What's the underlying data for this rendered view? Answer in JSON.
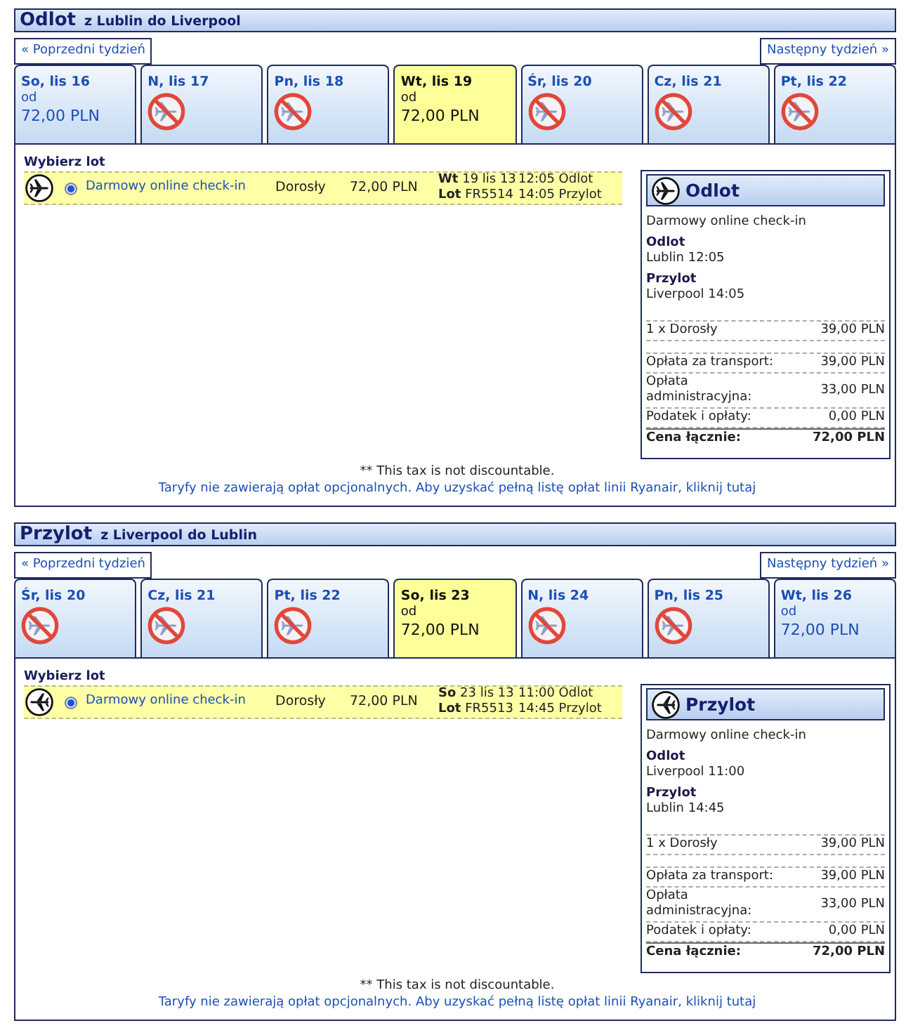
{
  "sections": [
    {
      "kind": "outbound",
      "title": "Odlot",
      "route": "z Lublin do Liverpool",
      "prev_week": "« Poprzedni tydzień",
      "next_week": "Następny tydzień »",
      "days": [
        {
          "label": "So, lis 16",
          "available": true,
          "from": "od",
          "price": "72,00 PLN",
          "selected": false
        },
        {
          "label": "N, lis 17",
          "available": false,
          "selected": false
        },
        {
          "label": "Pn, lis 18",
          "available": false,
          "selected": false
        },
        {
          "label": "Wt, lis 19",
          "available": true,
          "from": "od",
          "price": "72,00 PLN",
          "selected": true
        },
        {
          "label": "Śr, lis 20",
          "available": false,
          "selected": false
        },
        {
          "label": "Cz, lis 21",
          "available": false,
          "selected": false
        },
        {
          "label": "Pt, lis 22",
          "available": false,
          "selected": false
        }
      ],
      "choose_label": "Wybierz lot",
      "flight": {
        "selected": true,
        "fare": "Darmowy online check-in",
        "passenger": "Dorosły",
        "price": "72,00 PLN",
        "date": "**Wt** 19 lis 13",
        "flight_number": "**Lot** FR5514",
        "departure": "12:05 Odlot",
        "arrival": "14:05 Przylot"
      },
      "summary": {
        "title": "Odlot",
        "fare": "Darmowy online check-in",
        "departure_heading": "Odlot",
        "departure": "Lublin 12:05",
        "arrival_heading": "Przylot",
        "arrival": "Liverpool 14:05",
        "passengers": [
          {
            "label": "1 x Dorosły",
            "amount": "39,00 PLN"
          }
        ],
        "fees": [
          {
            "label": "Opłata za transport:",
            "amount": "39,00 PLN"
          },
          {
            "label": "Opłata administracyjna:",
            "amount": "33,00 PLN"
          },
          {
            "label": "Podatek i opłaty:",
            "amount": "0,00 PLN"
          }
        ],
        "total_label": "Cena łącznie:",
        "total": "72,00 PLN"
      },
      "note": "** This tax is not discountable.",
      "fees_link": "Taryfy nie zawierają opłat opcjonalnych. Aby uzyskać pełną listę opłat linii Ryanair, kliknij tutaj"
    },
    {
      "kind": "return",
      "title": "Przylot",
      "route": "z Liverpool do Lublin",
      "prev_week": "« Poprzedni tydzień",
      "next_week": "Następny tydzień »",
      "days": [
        {
          "label": "Śr, lis 20",
          "available": false,
          "selected": false
        },
        {
          "label": "Cz, lis 21",
          "available": false,
          "selected": false
        },
        {
          "label": "Pt, lis 22",
          "available": false,
          "selected": false
        },
        {
          "label": "So, lis 23",
          "available": true,
          "from": "od",
          "price": "72,00 PLN",
          "selected": true
        },
        {
          "label": "N, lis 24",
          "available": false,
          "selected": false
        },
        {
          "label": "Pn, lis 25",
          "available": false,
          "selected": false
        },
        {
          "label": "Wt, lis 26",
          "available": true,
          "from": "od",
          "price": "72,00 PLN",
          "selected": false
        }
      ],
      "choose_label": "Wybierz lot",
      "flight": {
        "selected": true,
        "fare": "Darmowy online check-in",
        "passenger": "Dorosły",
        "price": "72,00 PLN",
        "date": "**So** 23 lis 13",
        "flight_number": "**Lot** FR5513",
        "departure": "11:00 Odlot",
        "arrival": "14:45 Przylot"
      },
      "summary": {
        "title": "Przylot",
        "fare": "Darmowy online check-in",
        "departure_heading": "Odlot",
        "departure": "Liverpool 11:00",
        "arrival_heading": "Przylot",
        "arrival": "Lublin 14:45",
        "passengers": [
          {
            "label": "1 x Dorosły",
            "amount": "39,00 PLN"
          }
        ],
        "fees": [
          {
            "label": "Opłata za transport:",
            "amount": "39,00 PLN"
          },
          {
            "label": "Opłata administracyjna:",
            "amount": "33,00 PLN"
          },
          {
            "label": "Podatek i opłaty:",
            "amount": "0,00 PLN"
          }
        ],
        "total_label": "Cena łącznie:",
        "total": "72,00 PLN"
      },
      "note": "** This tax is not discountable.",
      "fees_link": "Taryfy nie zawierają opłat opcjonalnych. Aby uzyskać pełną listę opłat linii Ryanair, kliknij tutaj"
    }
  ]
}
